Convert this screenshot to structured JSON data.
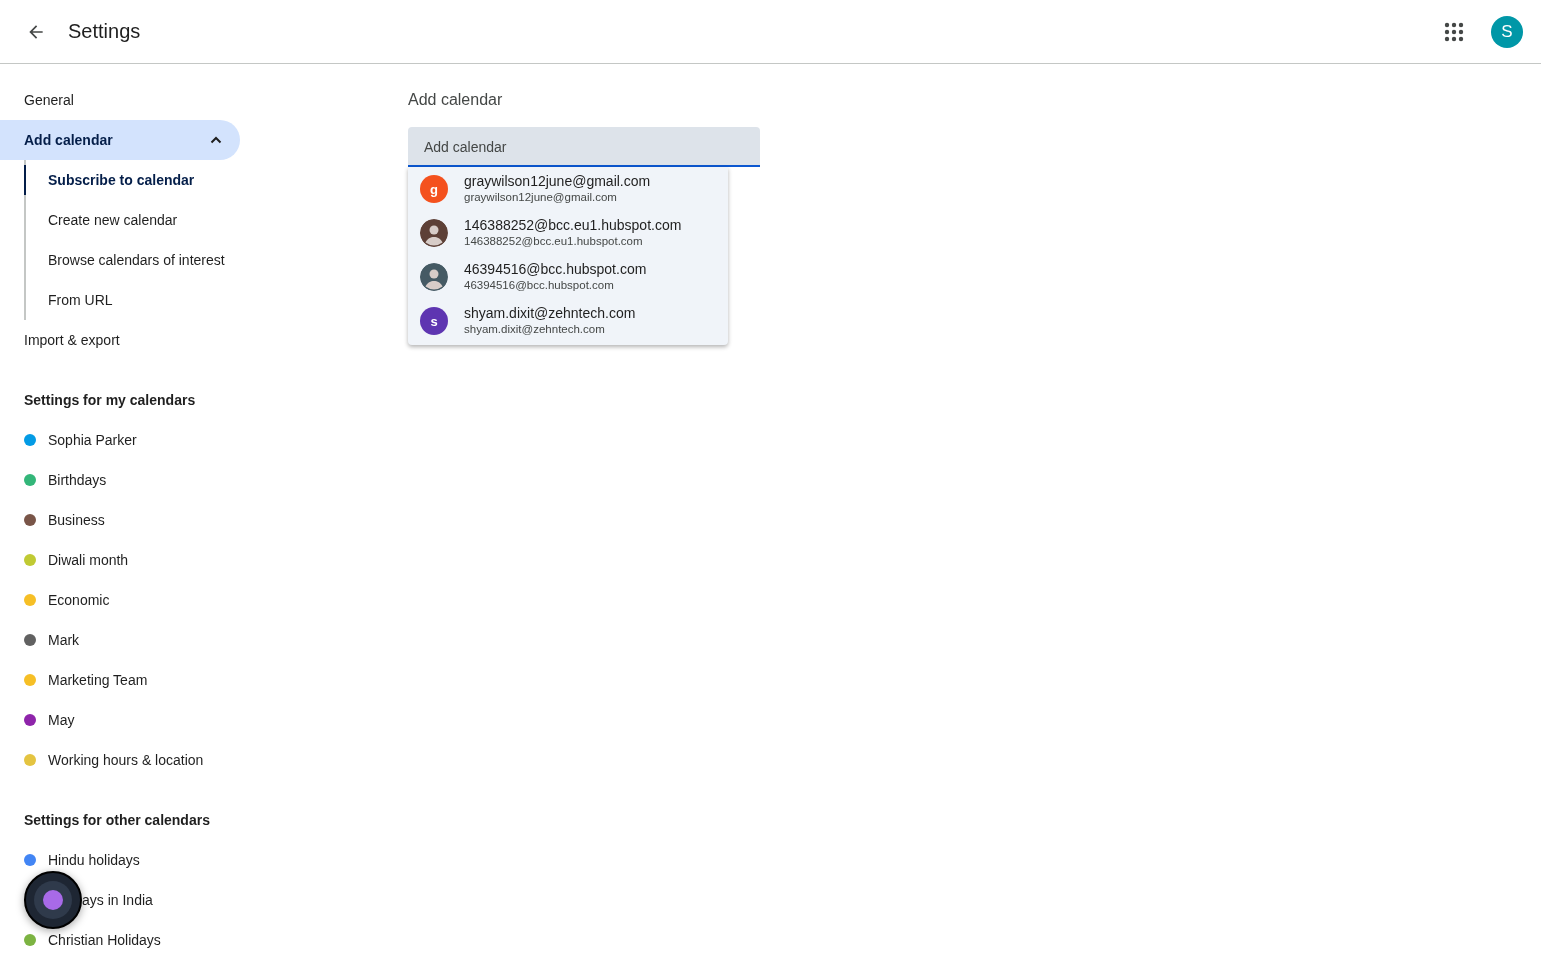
{
  "header": {
    "title": "Settings"
  },
  "account": {
    "initial": "S"
  },
  "sidebar": {
    "items": [
      {
        "label": "General",
        "selected": false
      },
      {
        "label": "Add calendar",
        "selected": true,
        "expanded": true,
        "children": [
          {
            "label": "Subscribe to calendar",
            "selected": true
          },
          {
            "label": "Create new calendar",
            "selected": false
          },
          {
            "label": "Browse calendars of interest",
            "selected": false
          },
          {
            "label": "From URL",
            "selected": false
          }
        ]
      },
      {
        "label": "Import & export",
        "selected": false
      }
    ],
    "sections": [
      {
        "title": "Settings for my calendars",
        "calendars": [
          {
            "name": "Sophia Parker",
            "color": "#039be5"
          },
          {
            "name": "Birthdays",
            "color": "#33b679"
          },
          {
            "name": "Business",
            "color": "#795548"
          },
          {
            "name": "Diwali month",
            "color": "#c0ca33"
          },
          {
            "name": "Economic",
            "color": "#f6bf26"
          },
          {
            "name": "Mark",
            "color": "#616161"
          },
          {
            "name": "Marketing Team",
            "color": "#f6bf26"
          },
          {
            "name": "May",
            "color": "#8e24aa"
          },
          {
            "name": "Working hours & location",
            "color": "#e4c441"
          }
        ]
      },
      {
        "title": "Settings for other calendars",
        "calendars": [
          {
            "kind": "calendar",
            "name": "Hindu holidays",
            "color": "#4285f4"
          },
          {
            "kind": "covered",
            "name": "ays in India"
          },
          {
            "kind": "calendar",
            "name": "Christian Holidays",
            "color": "#7cb342"
          }
        ]
      }
    ]
  },
  "main": {
    "title": "Add calendar",
    "field": {
      "placeholder": "Add calendar"
    },
    "suggestions": [
      {
        "kind": "letter",
        "initial": "g",
        "color": "#f4511e",
        "name": "graywilson12june@gmail.com",
        "email": "graywilson12june@gmail.com"
      },
      {
        "kind": "person",
        "color": "#5d4037",
        "name": "146388252@bcc.eu1.hubspot.com",
        "email": "146388252@bcc.eu1.hubspot.com"
      },
      {
        "kind": "person",
        "color": "#455a64",
        "name": "46394516@bcc.hubspot.com",
        "email": "46394516@bcc.hubspot.com"
      },
      {
        "kind": "letter",
        "initial": "s",
        "color": "#5e35b1",
        "name": "shyam.dixit@zehntech.com",
        "email": "shyam.dixit@zehntech.com"
      }
    ]
  }
}
